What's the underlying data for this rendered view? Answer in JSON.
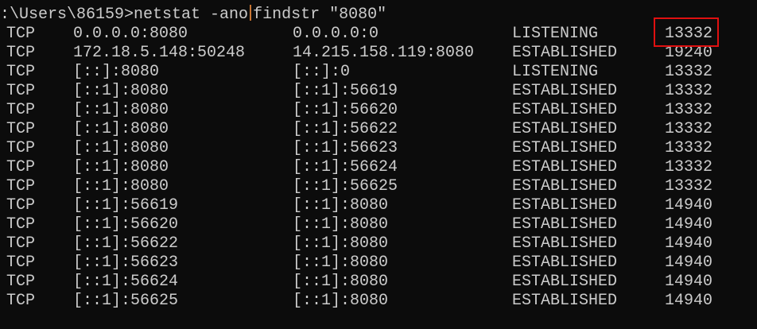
{
  "terminal": {
    "prompt": ":\\Users\\86159>",
    "command_part1": "netstat -ano",
    "command_part2": "findstr \"8080\"",
    "rows": [
      {
        "proto": "TCP",
        "local": "0.0.0.0:8080",
        "foreign": "0.0.0.0:0",
        "state": "LISTENING",
        "pid": "13332"
      },
      {
        "proto": "TCP",
        "local": "172.18.5.148:50248",
        "foreign": "14.215.158.119:8080",
        "state": "ESTABLISHED",
        "pid": "19240"
      },
      {
        "proto": "TCP",
        "local": "[::]:8080",
        "foreign": "[::]:0",
        "state": "LISTENING",
        "pid": "13332"
      },
      {
        "proto": "TCP",
        "local": "[::1]:8080",
        "foreign": "[::1]:56619",
        "state": "ESTABLISHED",
        "pid": "13332"
      },
      {
        "proto": "TCP",
        "local": "[::1]:8080",
        "foreign": "[::1]:56620",
        "state": "ESTABLISHED",
        "pid": "13332"
      },
      {
        "proto": "TCP",
        "local": "[::1]:8080",
        "foreign": "[::1]:56622",
        "state": "ESTABLISHED",
        "pid": "13332"
      },
      {
        "proto": "TCP",
        "local": "[::1]:8080",
        "foreign": "[::1]:56623",
        "state": "ESTABLISHED",
        "pid": "13332"
      },
      {
        "proto": "TCP",
        "local": "[::1]:8080",
        "foreign": "[::1]:56624",
        "state": "ESTABLISHED",
        "pid": "13332"
      },
      {
        "proto": "TCP",
        "local": "[::1]:8080",
        "foreign": "[::1]:56625",
        "state": "ESTABLISHED",
        "pid": "13332"
      },
      {
        "proto": "TCP",
        "local": "[::1]:56619",
        "foreign": "[::1]:8080",
        "state": "ESTABLISHED",
        "pid": "14940"
      },
      {
        "proto": "TCP",
        "local": "[::1]:56620",
        "foreign": "[::1]:8080",
        "state": "ESTABLISHED",
        "pid": "14940"
      },
      {
        "proto": "TCP",
        "local": "[::1]:56622",
        "foreign": "[::1]:8080",
        "state": "ESTABLISHED",
        "pid": "14940"
      },
      {
        "proto": "TCP",
        "local": "[::1]:56623",
        "foreign": "[::1]:8080",
        "state": "ESTABLISHED",
        "pid": "14940"
      },
      {
        "proto": "TCP",
        "local": "[::1]:56624",
        "foreign": "[::1]:8080",
        "state": "ESTABLISHED",
        "pid": "14940"
      },
      {
        "proto": "TCP",
        "local": "[::1]:56625",
        "foreign": "[::1]:8080",
        "state": "ESTABLISHED",
        "pid": "14940"
      }
    ]
  },
  "colors": {
    "background": "#0c0c0c",
    "text": "#cccccc",
    "highlight_box": "#e01010",
    "caret": "#c87533"
  }
}
